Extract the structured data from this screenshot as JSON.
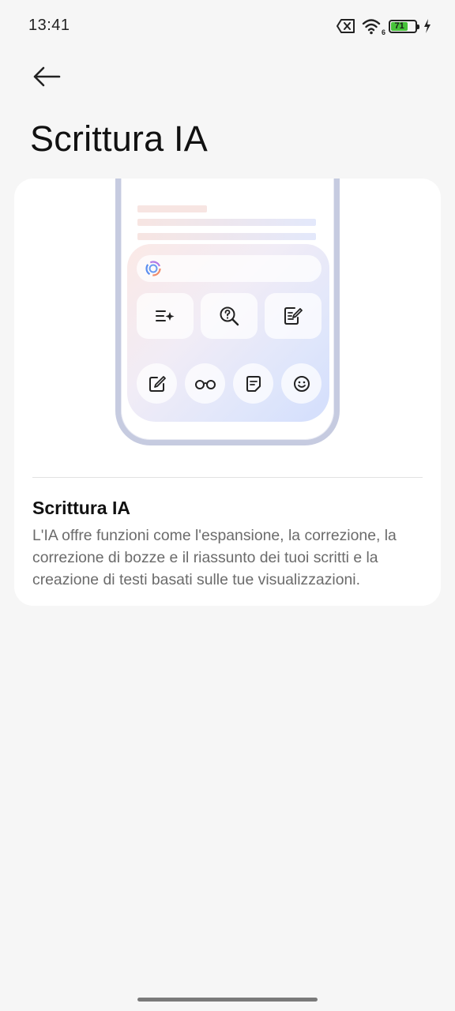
{
  "status_bar": {
    "time": "13:41",
    "wifi_badge": "6",
    "battery_level": "71",
    "battery_fraction": 0.71,
    "icons": [
      "sim-card-error-icon",
      "wifi-icon",
      "battery-icon",
      "charging-bolt-icon"
    ]
  },
  "header": {
    "back_icon": "arrow-left-icon",
    "title": "Scrittura IA"
  },
  "card": {
    "illustration": {
      "row_1_tools": [
        "expand-sparkle-icon",
        "search-question-icon",
        "edit-note-icon"
      ],
      "row_2_tools": [
        "pen-write-icon",
        "glasses-icon",
        "summary-doc-icon",
        "smiley-icon"
      ]
    },
    "title": "Scrittura IA",
    "description": "L'IA offre funzioni come l'espansione, la correzione, la correzione di bozze e il riassunto dei tuoi scritti e la creazione di testi basati sulle tue visualizzazioni."
  },
  "colors": {
    "background": "#f6f6f6",
    "card": "#ffffff",
    "battery_green": "#47c23a",
    "frame": "#c6cbe0"
  }
}
